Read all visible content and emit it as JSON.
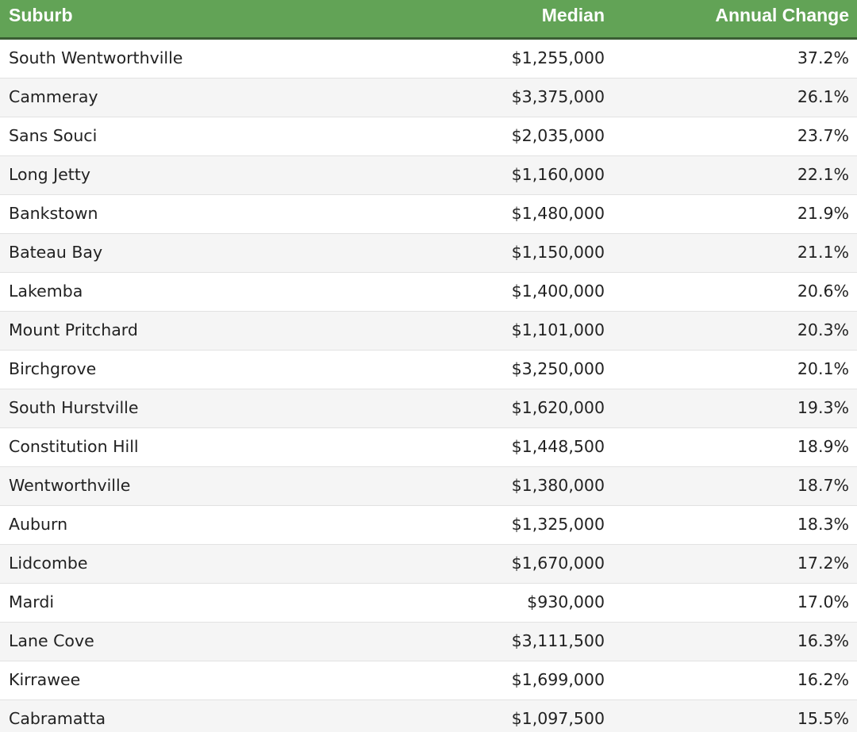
{
  "table": {
    "columns": [
      "Suburb",
      "Median",
      "Annual Change"
    ],
    "rows": [
      [
        "South Wentworthville",
        "$1,255,000",
        "37.2%"
      ],
      [
        "Cammeray",
        "$3,375,000",
        "26.1%"
      ],
      [
        "Sans Souci",
        "$2,035,000",
        "23.7%"
      ],
      [
        "Long Jetty",
        "$1,160,000",
        "22.1%"
      ],
      [
        "Bankstown",
        "$1,480,000",
        "21.9%"
      ],
      [
        "Bateau Bay",
        "$1,150,000",
        "21.1%"
      ],
      [
        "Lakemba",
        "$1,400,000",
        "20.6%"
      ],
      [
        "Mount Pritchard",
        "$1,101,000",
        "20.3%"
      ],
      [
        "Birchgrove",
        "$3,250,000",
        "20.1%"
      ],
      [
        "South Hurstville",
        "$1,620,000",
        "19.3%"
      ],
      [
        "Constitution Hill",
        "$1,448,500",
        "18.9%"
      ],
      [
        "Wentworthville",
        "$1,380,000",
        "18.7%"
      ],
      [
        "Auburn",
        "$1,325,000",
        "18.3%"
      ],
      [
        "Lidcombe",
        "$1,670,000",
        "17.2%"
      ],
      [
        "Mardi",
        "$930,000",
        "17.0%"
      ],
      [
        "Lane Cove",
        "$3,111,500",
        "16.3%"
      ],
      [
        "Kirrawee",
        "$1,699,000",
        "16.2%"
      ],
      [
        "Cabramatta",
        "$1,097,500",
        "15.5%"
      ]
    ]
  },
  "colors": {
    "header_bg": "#62a356",
    "header_border": "#3a5e33",
    "header_text": "#ffffff",
    "row_alt_bg": "#f5f5f5",
    "text": "#222222"
  },
  "chart_data": {
    "type": "table",
    "columns": [
      "Suburb",
      "Median",
      "Annual Change"
    ],
    "rows": [
      [
        "South Wentworthville",
        "$1,255,000",
        "37.2%"
      ],
      [
        "Cammeray",
        "$3,375,000",
        "26.1%"
      ],
      [
        "Sans Souci",
        "$2,035,000",
        "23.7%"
      ],
      [
        "Long Jetty",
        "$1,160,000",
        "22.1%"
      ],
      [
        "Bankstown",
        "$1,480,000",
        "21.9%"
      ],
      [
        "Bateau Bay",
        "$1,150,000",
        "21.1%"
      ],
      [
        "Lakemba",
        "$1,400,000",
        "20.6%"
      ],
      [
        "Mount Pritchard",
        "$1,101,000",
        "20.3%"
      ],
      [
        "Birchgrove",
        "$3,250,000",
        "20.1%"
      ],
      [
        "South Hurstville",
        "$1,620,000",
        "19.3%"
      ],
      [
        "Constitution Hill",
        "$1,448,500",
        "18.9%"
      ],
      [
        "Wentworthville",
        "$1,380,000",
        "18.7%"
      ],
      [
        "Auburn",
        "$1,325,000",
        "18.3%"
      ],
      [
        "Lidcombe",
        "$1,670,000",
        "17.2%"
      ],
      [
        "Mardi",
        "$930,000",
        "17.0%"
      ],
      [
        "Lane Cove",
        "$3,111,500",
        "16.3%"
      ],
      [
        "Kirrawee",
        "$1,699,000",
        "16.2%"
      ],
      [
        "Cabramatta",
        "$1,097,500",
        "15.5%"
      ]
    ]
  }
}
